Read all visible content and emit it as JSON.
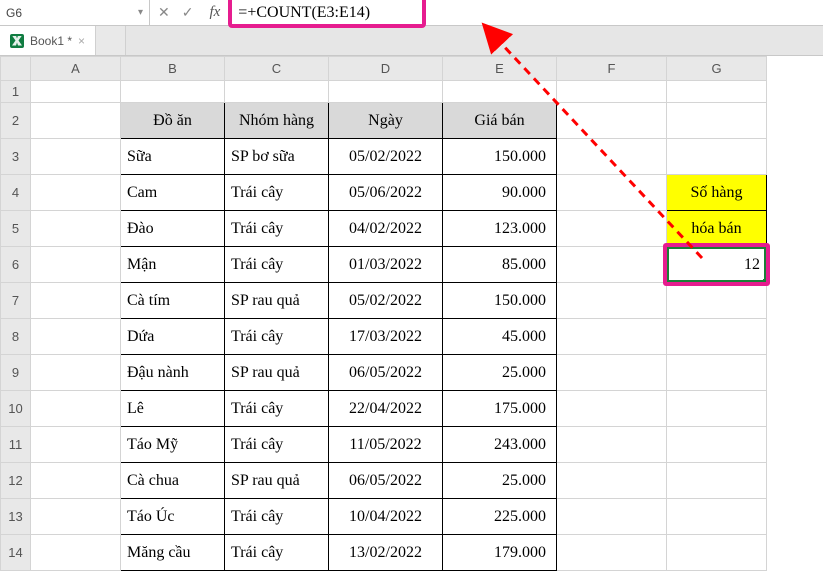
{
  "nameBox": "G6",
  "formula": "=+COUNT(E3:E14)",
  "fxLabel": "fx",
  "sheetTab": "Book1 *",
  "columns": [
    "A",
    "B",
    "C",
    "D",
    "E",
    "F",
    "G"
  ],
  "rows": [
    "1",
    "2",
    "3",
    "4",
    "5",
    "6",
    "7",
    "8",
    "9",
    "10",
    "11",
    "12",
    "13",
    "14"
  ],
  "headers": {
    "B": "Đồ ăn",
    "C": "Nhóm hàng",
    "D": "Ngày",
    "E": "Giá bán"
  },
  "table": [
    {
      "B": "Sữa",
      "C": "SP bơ sữa",
      "D": "05/02/2022",
      "E": "150.000"
    },
    {
      "B": "Cam",
      "C": "Trái cây",
      "D": "05/06/2022",
      "E": "90.000"
    },
    {
      "B": "Đào",
      "C": "Trái cây",
      "D": "04/02/2022",
      "E": "123.000"
    },
    {
      "B": "Mận",
      "C": "Trái cây",
      "D": "01/03/2022",
      "E": "85.000"
    },
    {
      "B": "Cà tím",
      "C": "SP rau quả",
      "D": "05/02/2022",
      "E": "150.000"
    },
    {
      "B": "Dứa",
      "C": "Trái cây",
      "D": "17/03/2022",
      "E": "45.000"
    },
    {
      "B": "Đậu nành",
      "C": "SP rau quả",
      "D": "06/05/2022",
      "E": "25.000"
    },
    {
      "B": "Lê",
      "C": "Trái cây",
      "D": "22/04/2022",
      "E": "175.000"
    },
    {
      "B": "Táo Mỹ",
      "C": "Trái cây",
      "D": "11/05/2022",
      "E": "243.000"
    },
    {
      "B": "Cà chua",
      "C": "SP rau quả",
      "D": "06/05/2022",
      "E": "25.000"
    },
    {
      "B": "Táo Úc",
      "C": "Trái cây",
      "D": "10/04/2022",
      "E": "225.000"
    },
    {
      "B": "Măng cầu",
      "C": "Trái cây",
      "D": "13/02/2022",
      "E": "179.000"
    }
  ],
  "resultLabel1": "Số hàng",
  "resultLabel2": "hóa bán",
  "resultValue": "12",
  "highlightColor": "#e61c8f"
}
